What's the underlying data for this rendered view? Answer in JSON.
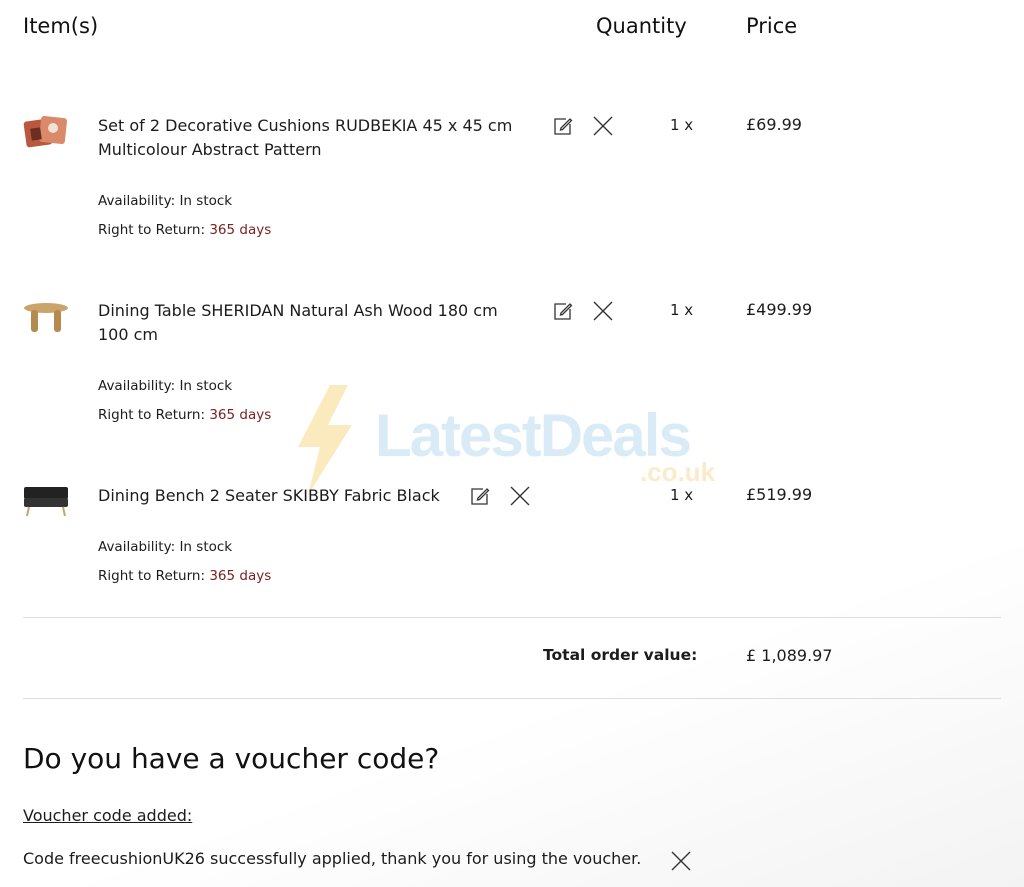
{
  "header": {
    "items_label": "Item(s)",
    "quantity_label": "Quantity",
    "price_label": "Price"
  },
  "items": [
    {
      "name_line1": "Set of 2 Decorative Cushions RUDBEKIA 45 x 45 cm",
      "name_line2": "Multicolour Abstract Pattern",
      "qty": "1 x",
      "price": "£69.99",
      "availability_label": "Availability:",
      "availability": "In stock",
      "return_label": "Right to Return:",
      "return_value": "365 days",
      "thumb_icon": "cushions-thumbnail"
    },
    {
      "name_line1": "Dining Table SHERIDAN Natural Ash Wood 180 cm",
      "name_line2": "100 cm",
      "qty": "1 x",
      "price": "£499.99",
      "availability_label": "Availability:",
      "availability": "In stock",
      "return_label": "Right to Return:",
      "return_value": "365 days",
      "thumb_icon": "table-thumbnail"
    },
    {
      "name_line1": "Dining Bench 2 Seater SKIBBY Fabric Black",
      "name_line2": "",
      "qty": "1 x",
      "price": "£519.99",
      "availability_label": "Availability:",
      "availability": "In stock",
      "return_label": "Right to Return:",
      "return_value": "365 days",
      "thumb_icon": "bench-thumbnail"
    }
  ],
  "actions": {
    "edit_icon": "edit-icon",
    "remove_icon": "close-icon"
  },
  "total": {
    "label": "Total order value:",
    "value": "£ 1,089.97"
  },
  "voucher": {
    "title": "Do you have a voucher code?",
    "added_label": "Voucher code added:",
    "message": "Code freecushionUK26 successfully applied, thank you for using the voucher."
  },
  "watermark": {
    "brand": "LatestDeals",
    "sub": ".co.uk"
  },
  "colors": {
    "accent": "#7a2222",
    "text": "#1c1c1c",
    "divider": "#dedede"
  }
}
